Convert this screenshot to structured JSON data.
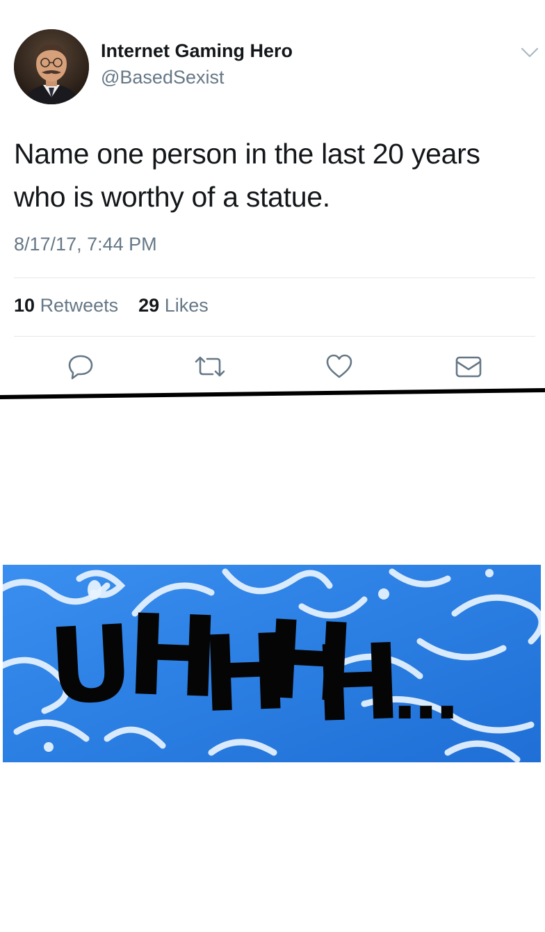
{
  "tweet": {
    "display_name": "Internet Gaming Hero",
    "handle": "@BasedSexist",
    "text": "Name one person in the last 20 years who is worthy of a statue.",
    "timestamp": "8/17/17, 7:44 PM",
    "retweets_count": "10",
    "retweets_label": "Retweets",
    "likes_count": "29",
    "likes_label": "Likes",
    "icons": {
      "menu": "chevron-down-icon",
      "reply": "reply-icon",
      "retweet": "retweet-icon",
      "like": "heart-icon",
      "dm": "envelope-icon"
    },
    "colors": {
      "text": "#14171a",
      "secondary": "#657786",
      "divider": "#e1e8ed"
    }
  },
  "meme": {
    "letters": [
      "U",
      "H",
      "H",
      "H",
      "H",
      "..."
    ],
    "colors": {
      "background": "#2a7de1",
      "swirl": "#e8f4ff",
      "text": "#050505"
    }
  }
}
